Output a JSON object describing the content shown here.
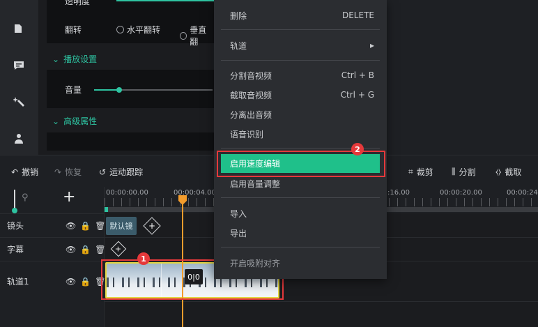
{
  "props": {
    "opacity_label": "透明度",
    "flip_label": "翻转",
    "flip_h": "水平翻转",
    "flip_v": "垂直翻",
    "playback_section": "播放设置",
    "volume_label": "音量",
    "advanced_section": "高级属性"
  },
  "toolbar": {
    "undo": "撤销",
    "redo": "恢复",
    "motion_track": "运动跟踪",
    "crop": "裁剪",
    "split": "分割",
    "clip": "截取"
  },
  "ruler": {
    "ticks": [
      "00:00:00.00",
      "00:00:04.00",
      ":16.00",
      "00:00:20.00",
      "00:00:24.0"
    ]
  },
  "tracks": {
    "lens": "镜头",
    "subtitle": "字幕",
    "track1": "轨道1",
    "lens_clip": "默认镜"
  },
  "menu": {
    "delete": "删除",
    "delete_sc": "DELETE",
    "track": "轨道",
    "split_av": "分割音视频",
    "split_av_sc": "Ctrl + B",
    "clip_av": "截取音视频",
    "clip_av_sc": "Ctrl + G",
    "separate_audio": "分离出音频",
    "speech_recognition": "语音识别",
    "speed_edit": "启用速度编辑",
    "volume_adjust": "启用音量调整",
    "import": "导入",
    "export": "导出",
    "snap": "开启吸附对齐"
  },
  "badges": {
    "one": "1",
    "two": "2"
  },
  "colors": {
    "accent": "#2ec3a1",
    "highlight": "#1fc08a",
    "annotation": "#e5393b",
    "playhead": "#f39c2c"
  }
}
